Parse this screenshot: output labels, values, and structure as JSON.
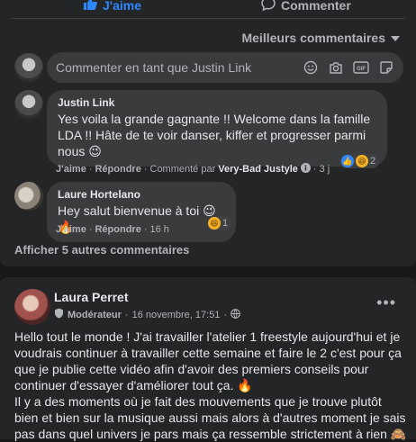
{
  "actions": {
    "like_label": "J'aime",
    "comment_label": "Commenter"
  },
  "sort": {
    "label": "Meilleurs commentaires"
  },
  "compose": {
    "placeholder": "Commenter en tant que Justin Link"
  },
  "comments": [
    {
      "author": "Justin Link",
      "text": "Yes voila la grande gagnante !! Welcome dans la famille LDA !! Hâte de te voir danser, kiffer et progresser parmi nous 😉",
      "like": "J'aime",
      "reply": "Répondre",
      "commented_by_prefix": "Commenté par",
      "commented_by": "Very-Bad Justyle",
      "time": "3 j",
      "reaction_count": "2"
    },
    {
      "author": "Laure Hortelano",
      "text": "Hey salut bienvenue à toi 😉🔥",
      "like": "J'aime",
      "reply": "Répondre",
      "time": "16 h",
      "reaction_count": "1"
    }
  ],
  "more_comments": "Afficher 5 autres commentaires",
  "post": {
    "author": "Laura Perret",
    "role": "Modérateur",
    "date": "16 novembre, 17:51",
    "text": "Hello tout le monde ! J'ai travailler l'atelier 1 freestyle aujourd'hui et je voudrais continuer à travailler cette semaine et faire le 2 c'est pour ça que je publie cette vidéo afin d'avoir des premiers conseils pour continuer d'essayer d'améliorer tout ça. 🔥\nIl y a des moments où je fait des mouvements que je trouve plutôt bien et bien sur la musique aussi mais alors à d'autres moment je sais pas dans quel univers je pars mais ça ressemble strictement à rien 🙈"
  },
  "colors": {
    "accent": "#2d88ff",
    "card": "#242526",
    "bubble": "#3a3b3c",
    "page": "#18191a"
  }
}
